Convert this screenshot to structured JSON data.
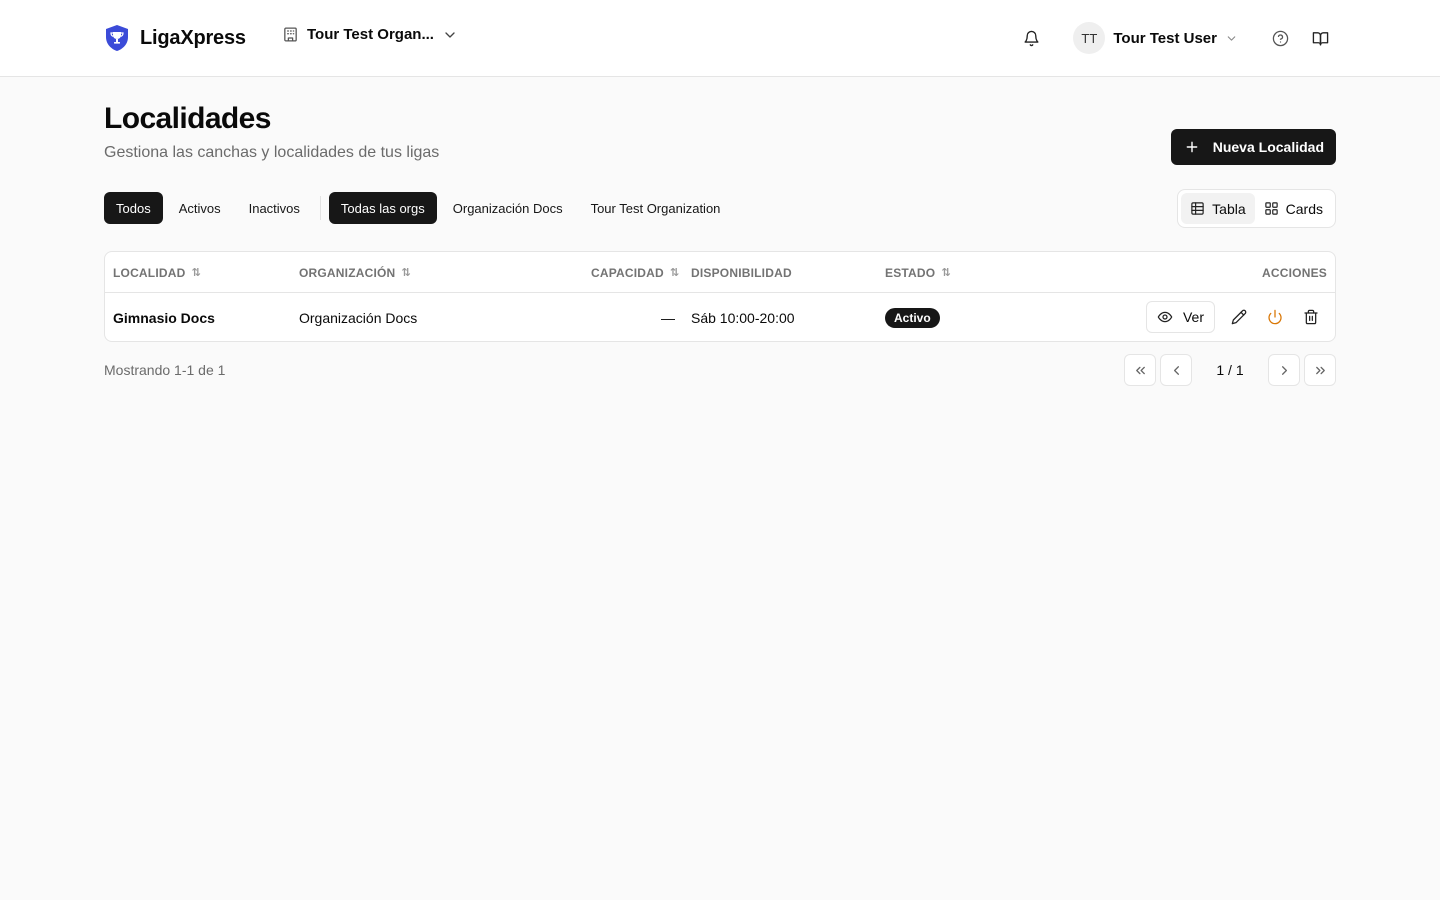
{
  "header": {
    "brand": "LigaXpress",
    "org_selector": "Tour Test Organ...",
    "user_initials": "TT",
    "user_name": "Tour Test User"
  },
  "page": {
    "title": "Localidades",
    "subtitle": "Gestiona las canchas y localidades de tus ligas",
    "new_button": "Nueva Localidad"
  },
  "filters": {
    "status": [
      "Todos",
      "Activos",
      "Inactivos"
    ],
    "orgs": [
      "Todas las orgs",
      "Organización Docs",
      "Tour Test Organization"
    ]
  },
  "view_toggle": {
    "table": "Tabla",
    "cards": "Cards"
  },
  "table": {
    "columns": {
      "localidad": "LOCALIDAD",
      "organizacion": "ORGANIZACIÓN",
      "capacidad": "CAPACIDAD",
      "disponibilidad": "DISPONIBILIDAD",
      "estado": "ESTADO",
      "acciones": "ACCIONES"
    },
    "rows": [
      {
        "localidad": "Gimnasio Docs",
        "organizacion": "Organización Docs",
        "capacidad": "—",
        "disponibilidad": "Sáb 10:00-20:00",
        "estado": "Activo",
        "ver": "Ver"
      }
    ]
  },
  "footer": {
    "showing": "Mostrando 1-1 de 1",
    "page_label": "1 / 1"
  },
  "colors": {
    "primary": "#171717",
    "warning_icon": "#d97706",
    "muted_text": "#6b6b6b",
    "brand_shield": "#3b4bd8"
  }
}
